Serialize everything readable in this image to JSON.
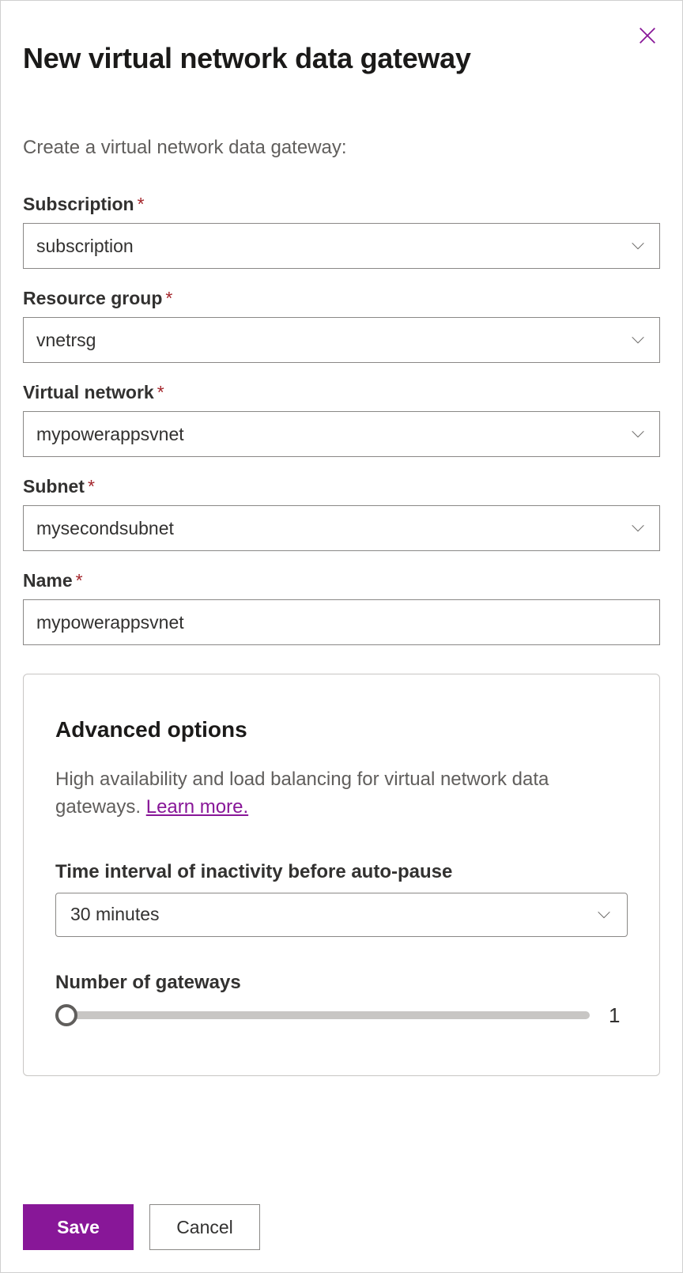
{
  "header": {
    "title": "New virtual network data gateway"
  },
  "subtitle": "Create a virtual network data gateway:",
  "fields": {
    "subscription": {
      "label": "Subscription",
      "value": "subscription",
      "required": true
    },
    "resource_group": {
      "label": "Resource group",
      "value": "vnetrsg",
      "required": true
    },
    "virtual_network": {
      "label": "Virtual network",
      "value": "mypowerappsvnet",
      "required": true
    },
    "subnet": {
      "label": "Subnet",
      "value": "mysecondsubnet",
      "required": true
    },
    "name": {
      "label": "Name",
      "value": "mypowerappsvnet",
      "required": true
    }
  },
  "advanced": {
    "title": "Advanced options",
    "description": "High availability and load balancing for virtual network data gateways. ",
    "learn_more": "Learn more.",
    "inactivity": {
      "label": "Time interval of inactivity before auto-pause",
      "value": "30 minutes"
    },
    "gateways": {
      "label": "Number of gateways",
      "value": "1"
    }
  },
  "buttons": {
    "save": "Save",
    "cancel": "Cancel"
  },
  "required_marker": "*"
}
